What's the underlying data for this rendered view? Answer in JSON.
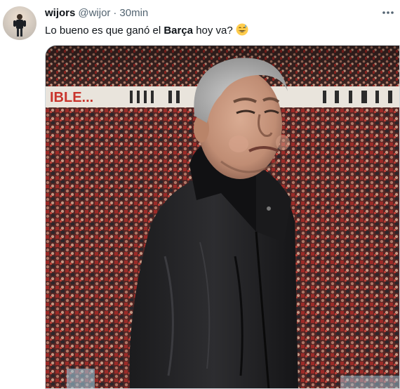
{
  "tweet": {
    "display_name": "wijors",
    "handle": "@wijor",
    "separator": "·",
    "time": "30min",
    "text_before": "Lo bueno es que ganó el ",
    "text_bold": "Barça",
    "text_after": " hoy va?",
    "emoji": "grinning-sweat-emoji",
    "banner_text": "IBLE..."
  },
  "icons": {
    "more": "more-horizontal-icon"
  },
  "colors": {
    "primary_text": "#0f1419",
    "secondary_text": "#536471",
    "border": "#cfd9de"
  }
}
